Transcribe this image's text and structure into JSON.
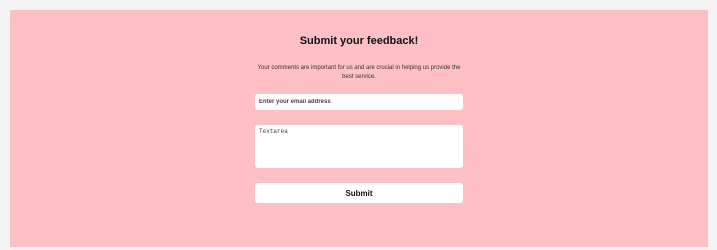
{
  "form": {
    "title": "Submit your feedback!",
    "description": "Your comments are important for us and are crucial in helping us provide the best service.",
    "email_placeholder": "Enter your email address",
    "email_value": "",
    "textarea_placeholder": "Textarea",
    "textarea_value": "",
    "submit_label": "Submit"
  },
  "colors": {
    "background": "#ffc0c5",
    "field": "#ffffff"
  }
}
